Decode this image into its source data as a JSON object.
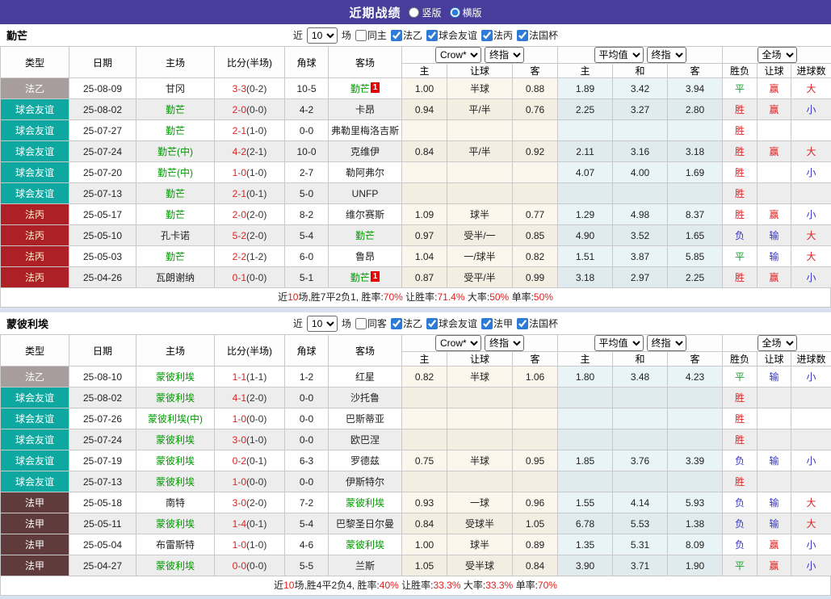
{
  "topbar": {
    "title": "近期战绩",
    "radios": [
      {
        "label": "竖版",
        "selected": false
      },
      {
        "label": "横版",
        "selected": true
      }
    ]
  },
  "labels": {
    "near": "近",
    "matches": "场"
  },
  "headers": {
    "type": "类型",
    "date": "日期",
    "home": "主场",
    "score": "比分(半场)",
    "corner": "角球",
    "away": "客场",
    "crow_select": "Crow*",
    "crow_final_select": "终指",
    "avg_select": "平均值",
    "avg_final_select": "终指",
    "scope_select": "全场",
    "sub": [
      "主",
      "让球",
      "客",
      "主",
      "和",
      "客",
      "胜负",
      "让球",
      "进球数"
    ]
  },
  "colors": {
    "topbar_bg": "#483D9B",
    "ligue2_badge": "#A79D9D",
    "friendly_badge": "#0FA8A1",
    "national3_badge": "#AC2026",
    "ligue1_badge": "#5F3B3B",
    "win_red": "#E02020",
    "draw_green": "#18A030",
    "lose_blue": "#3333CC",
    "self_team_green": "#009900",
    "crow_col_bg": "#FCF6EC",
    "avg_col_bg": "#E9F4F8"
  },
  "teams": [
    {
      "name": "勤芒",
      "recent_count": "10",
      "same_venue": {
        "label": "同主",
        "checked": false
      },
      "league_filters": [
        {
          "label": "法乙",
          "checked": true
        },
        {
          "label": "球会友谊",
          "checked": true
        },
        {
          "label": "法丙",
          "checked": true
        },
        {
          "label": "法国杯",
          "checked": true
        }
      ],
      "rows": [
        {
          "type": "法乙",
          "date": "25-08-09",
          "home": "甘冈",
          "home_self": false,
          "score": "3-3",
          "half": "(0-2)",
          "corner": "10-5",
          "away": "勤芒",
          "away_self": true,
          "away_badge": "1",
          "crow": [
            "1.00",
            "半球",
            "0.88"
          ],
          "avg": [
            "1.89",
            "3.42",
            "3.94"
          ],
          "res": [
            "平",
            "赢",
            "大"
          ]
        },
        {
          "type": "球会友谊",
          "date": "25-08-02",
          "home": "勤芒",
          "home_self": true,
          "score": "2-0",
          "half": "(0-0)",
          "corner": "4-2",
          "away": "卡昂",
          "away_self": false,
          "away_badge": "",
          "crow": [
            "0.94",
            "平/半",
            "0.76"
          ],
          "avg": [
            "2.25",
            "3.27",
            "2.80"
          ],
          "res": [
            "胜",
            "赢",
            "小"
          ]
        },
        {
          "type": "球会友谊",
          "date": "25-07-27",
          "home": "勤芒",
          "home_self": true,
          "score": "2-1",
          "half": "(1-0)",
          "corner": "0-0",
          "away": "弗勒里梅洛吉斯",
          "away_self": false,
          "away_badge": "",
          "crow": [
            "",
            "",
            ""
          ],
          "avg": [
            "",
            "",
            ""
          ],
          "res": [
            "胜",
            "",
            ""
          ]
        },
        {
          "type": "球会友谊",
          "date": "25-07-24",
          "home": "勤芒(中)",
          "home_self": true,
          "score": "4-2",
          "half": "(2-1)",
          "corner": "10-0",
          "away": "克维伊",
          "away_self": false,
          "away_badge": "",
          "crow": [
            "0.84",
            "平/半",
            "0.92"
          ],
          "avg": [
            "2.11",
            "3.16",
            "3.18"
          ],
          "res": [
            "胜",
            "赢",
            "大"
          ]
        },
        {
          "type": "球会友谊",
          "date": "25-07-20",
          "home": "勤芒(中)",
          "home_self": true,
          "score": "1-0",
          "half": "(1-0)",
          "corner": "2-7",
          "away": "勒阿弗尔",
          "away_self": false,
          "away_badge": "",
          "crow": [
            "",
            "",
            ""
          ],
          "avg": [
            "4.07",
            "4.00",
            "1.69"
          ],
          "res": [
            "胜",
            "",
            "小"
          ]
        },
        {
          "type": "球会友谊",
          "date": "25-07-13",
          "home": "勤芒",
          "home_self": true,
          "score": "2-1",
          "half": "(0-1)",
          "corner": "5-0",
          "away": "UNFP",
          "away_self": false,
          "away_badge": "",
          "crow": [
            "",
            "",
            ""
          ],
          "avg": [
            "",
            "",
            ""
          ],
          "res": [
            "胜",
            "",
            ""
          ]
        },
        {
          "type": "法丙",
          "date": "25-05-17",
          "home": "勤芒",
          "home_self": true,
          "score": "2-0",
          "half": "(2-0)",
          "corner": "8-2",
          "away": "维尔赛斯",
          "away_self": false,
          "away_badge": "",
          "crow": [
            "1.09",
            "球半",
            "0.77"
          ],
          "avg": [
            "1.29",
            "4.98",
            "8.37"
          ],
          "res": [
            "胜",
            "赢",
            "小"
          ]
        },
        {
          "type": "法丙",
          "date": "25-05-10",
          "home": "孔卡诺",
          "home_self": false,
          "score": "5-2",
          "half": "(2-0)",
          "corner": "5-4",
          "away": "勤芒",
          "away_self": true,
          "away_badge": "",
          "crow": [
            "0.97",
            "受半/一",
            "0.85"
          ],
          "avg": [
            "4.90",
            "3.52",
            "1.65"
          ],
          "res": [
            "负",
            "输",
            "大"
          ]
        },
        {
          "type": "法丙",
          "date": "25-05-03",
          "home": "勤芒",
          "home_self": true,
          "score": "2-2",
          "half": "(1-2)",
          "corner": "6-0",
          "away": "鲁昂",
          "away_self": false,
          "away_badge": "",
          "crow": [
            "1.04",
            "一/球半",
            "0.82"
          ],
          "avg": [
            "1.51",
            "3.87",
            "5.85"
          ],
          "res": [
            "平",
            "输",
            "大"
          ]
        },
        {
          "type": "法丙",
          "date": "25-04-26",
          "home": "瓦朗谢纳",
          "home_self": false,
          "score": "0-1",
          "half": "(0-0)",
          "corner": "5-1",
          "away": "勤芒",
          "away_self": true,
          "away_badge": "1",
          "crow": [
            "0.87",
            "受平/半",
            "0.99"
          ],
          "avg": [
            "3.18",
            "2.97",
            "2.25"
          ],
          "res": [
            "胜",
            "赢",
            "小"
          ]
        }
      ],
      "summary": [
        {
          "t": "近"
        },
        {
          "t": "10",
          "r": 1
        },
        {
          "t": "场,胜7平2负1, 胜率:"
        },
        {
          "t": "70%",
          "r": 1
        },
        {
          "t": " 让胜率:"
        },
        {
          "t": "71.4%",
          "r": 1
        },
        {
          "t": " 大率:"
        },
        {
          "t": "50%",
          "r": 1
        },
        {
          "t": " 单率:"
        },
        {
          "t": "50%",
          "r": 1
        }
      ]
    },
    {
      "name": "蒙彼利埃",
      "recent_count": "10",
      "same_venue": {
        "label": "同客",
        "checked": false
      },
      "league_filters": [
        {
          "label": "法乙",
          "checked": true
        },
        {
          "label": "球会友谊",
          "checked": true
        },
        {
          "label": "法甲",
          "checked": true
        },
        {
          "label": "法国杯",
          "checked": true
        }
      ],
      "rows": [
        {
          "type": "法乙",
          "date": "25-08-10",
          "home": "蒙彼利埃",
          "home_self": true,
          "score": "1-1",
          "half": "(1-1)",
          "corner": "1-2",
          "away": "红星",
          "away_self": false,
          "away_badge": "",
          "crow": [
            "0.82",
            "半球",
            "1.06"
          ],
          "avg": [
            "1.80",
            "3.48",
            "4.23"
          ],
          "res": [
            "平",
            "输",
            "小"
          ]
        },
        {
          "type": "球会友谊",
          "date": "25-08-02",
          "home": "蒙彼利埃",
          "home_self": true,
          "score": "4-1",
          "half": "(2-0)",
          "corner": "0-0",
          "away": "沙托鲁",
          "away_self": false,
          "away_badge": "",
          "crow": [
            "",
            "",
            ""
          ],
          "avg": [
            "",
            "",
            ""
          ],
          "res": [
            "胜",
            "",
            ""
          ]
        },
        {
          "type": "球会友谊",
          "date": "25-07-26",
          "home": "蒙彼利埃(中)",
          "home_self": true,
          "score": "1-0",
          "half": "(0-0)",
          "corner": "0-0",
          "away": "巴斯蒂亚",
          "away_self": false,
          "away_badge": "",
          "crow": [
            "",
            "",
            ""
          ],
          "avg": [
            "",
            "",
            ""
          ],
          "res": [
            "胜",
            "",
            ""
          ]
        },
        {
          "type": "球会友谊",
          "date": "25-07-24",
          "home": "蒙彼利埃",
          "home_self": true,
          "score": "3-0",
          "half": "(1-0)",
          "corner": "0-0",
          "away": "欧巴涅",
          "away_self": false,
          "away_badge": "",
          "crow": [
            "",
            "",
            ""
          ],
          "avg": [
            "",
            "",
            ""
          ],
          "res": [
            "胜",
            "",
            ""
          ]
        },
        {
          "type": "球会友谊",
          "date": "25-07-19",
          "home": "蒙彼利埃",
          "home_self": true,
          "score": "0-2",
          "half": "(0-1)",
          "corner": "6-3",
          "away": "罗德兹",
          "away_self": false,
          "away_badge": "",
          "crow": [
            "0.75",
            "半球",
            "0.95"
          ],
          "avg": [
            "1.85",
            "3.76",
            "3.39"
          ],
          "res": [
            "负",
            "输",
            "小"
          ]
        },
        {
          "type": "球会友谊",
          "date": "25-07-13",
          "home": "蒙彼利埃",
          "home_self": true,
          "score": "1-0",
          "half": "(0-0)",
          "corner": "0-0",
          "away": "伊斯特尔",
          "away_self": false,
          "away_badge": "",
          "crow": [
            "",
            "",
            ""
          ],
          "avg": [
            "",
            "",
            ""
          ],
          "res": [
            "胜",
            "",
            ""
          ]
        },
        {
          "type": "法甲",
          "date": "25-05-18",
          "home": "南特",
          "home_self": false,
          "score": "3-0",
          "half": "(2-0)",
          "corner": "7-2",
          "away": "蒙彼利埃",
          "away_self": true,
          "away_badge": "",
          "crow": [
            "0.93",
            "一球",
            "0.96"
          ],
          "avg": [
            "1.55",
            "4.14",
            "5.93"
          ],
          "res": [
            "负",
            "输",
            "大"
          ]
        },
        {
          "type": "法甲",
          "date": "25-05-11",
          "home": "蒙彼利埃",
          "home_self": true,
          "score": "1-4",
          "half": "(0-1)",
          "corner": "5-4",
          "away": "巴黎圣日尔曼",
          "away_self": false,
          "away_badge": "",
          "crow": [
            "0.84",
            "受球半",
            "1.05"
          ],
          "avg": [
            "6.78",
            "5.53",
            "1.38"
          ],
          "res": [
            "负",
            "输",
            "大"
          ]
        },
        {
          "type": "法甲",
          "date": "25-05-04",
          "home": "布雷斯特",
          "home_self": false,
          "score": "1-0",
          "half": "(1-0)",
          "corner": "4-6",
          "away": "蒙彼利埃",
          "away_self": true,
          "away_badge": "",
          "crow": [
            "1.00",
            "球半",
            "0.89"
          ],
          "avg": [
            "1.35",
            "5.31",
            "8.09"
          ],
          "res": [
            "负",
            "赢",
            "小"
          ]
        },
        {
          "type": "法甲",
          "date": "25-04-27",
          "home": "蒙彼利埃",
          "home_self": true,
          "score": "0-0",
          "half": "(0-0)",
          "corner": "5-5",
          "away": "兰斯",
          "away_self": false,
          "away_badge": "",
          "crow": [
            "1.05",
            "受半球",
            "0.84"
          ],
          "avg": [
            "3.90",
            "3.71",
            "1.90"
          ],
          "res": [
            "平",
            "赢",
            "小"
          ]
        }
      ],
      "summary": [
        {
          "t": "近"
        },
        {
          "t": "10",
          "r": 1
        },
        {
          "t": "场,胜4平2负4, 胜率:"
        },
        {
          "t": "40%",
          "r": 1
        },
        {
          "t": " 让胜率:"
        },
        {
          "t": "33.3%",
          "r": 1
        },
        {
          "t": " 大率:"
        },
        {
          "t": "33.3%",
          "r": 1
        },
        {
          "t": " 单率:"
        },
        {
          "t": "70%",
          "r": 1
        }
      ]
    }
  ]
}
